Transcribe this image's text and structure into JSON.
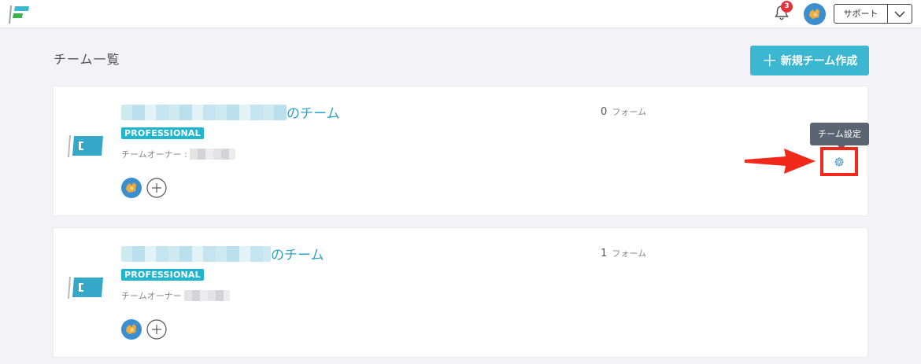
{
  "header": {
    "notification_count": "3",
    "support_label": "サポート"
  },
  "page": {
    "title": "チーム一覧",
    "new_team_plus": "＋",
    "new_team_label": "新規チーム作成"
  },
  "teams": [
    {
      "name_suffix": "のチーム",
      "plan": "PROFESSIONAL",
      "owner_label": "チームオーナー :",
      "form_count": "0",
      "form_unit": "フォーム"
    },
    {
      "name_suffix": "のチーム",
      "plan": "PROFESSIONAL",
      "owner_label": "チームオーナー",
      "form_count": "1",
      "form_unit": "フォーム"
    }
  ],
  "tooltip": {
    "team_settings": "チーム設定"
  },
  "colors": {
    "accent": "#3cb7d1",
    "badge": "#22b5ce",
    "highlight": "#f2281b",
    "notification": "#e2343d"
  },
  "icons": [
    "app-logo-icon",
    "bell-icon",
    "user-avatar-icon",
    "chevron-down-icon",
    "team-logo-icon",
    "add-member-icon",
    "gear-icon",
    "red-arrow-icon"
  ]
}
